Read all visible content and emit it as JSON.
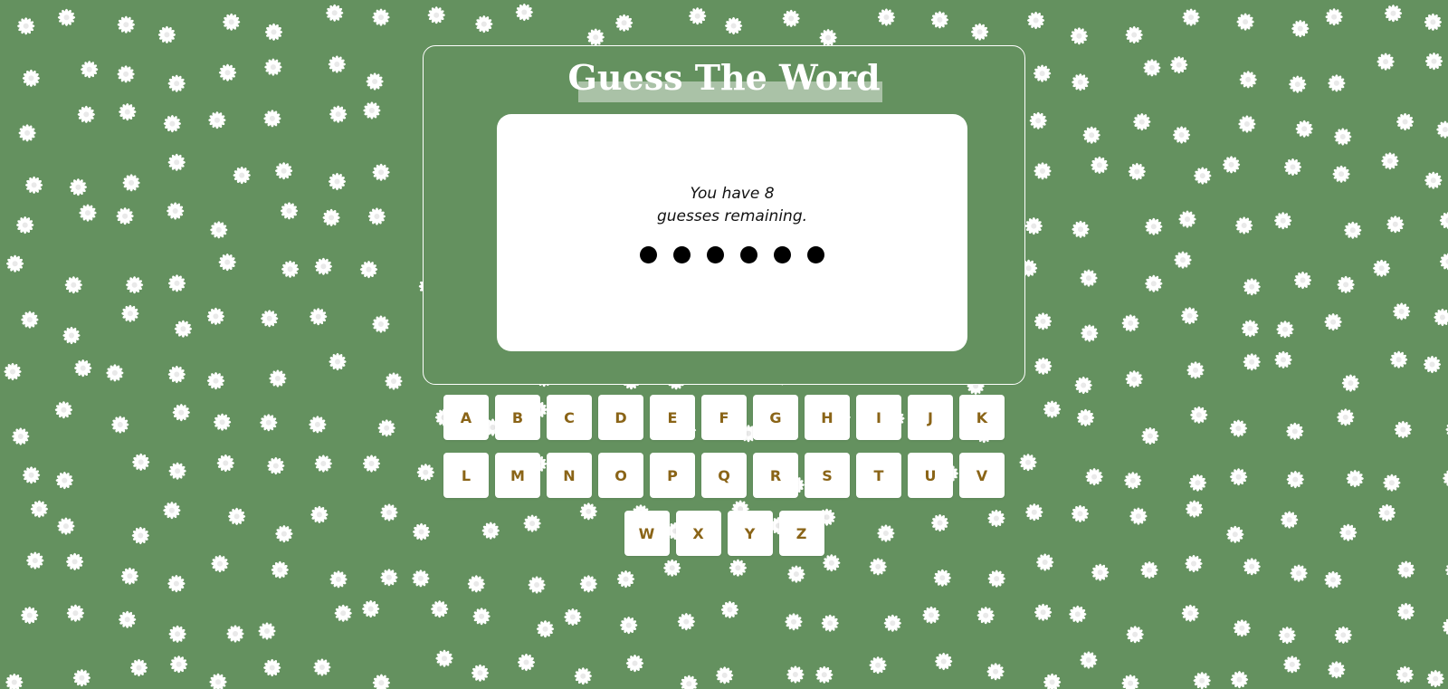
{
  "page": {
    "title": "Guess The Word",
    "background_color": "#64915f",
    "accent_color": "#8a6417",
    "background_pattern_icon": "daisy-flower-icon"
  },
  "message": {
    "line1": "You have 8",
    "line2": "guesses remaining."
  },
  "word_progress": {
    "hidden_letters": 6,
    "placeholder_icon": "black-dot-icon"
  },
  "keyboard": {
    "rows": [
      [
        "A",
        "B",
        "C",
        "D",
        "E",
        "F",
        "G",
        "H",
        "I",
        "J",
        "K"
      ],
      [
        "L",
        "M",
        "N",
        "O",
        "P",
        "Q",
        "R",
        "S",
        "T",
        "U",
        "V"
      ],
      [
        "W",
        "X",
        "Y",
        "Z"
      ]
    ]
  }
}
